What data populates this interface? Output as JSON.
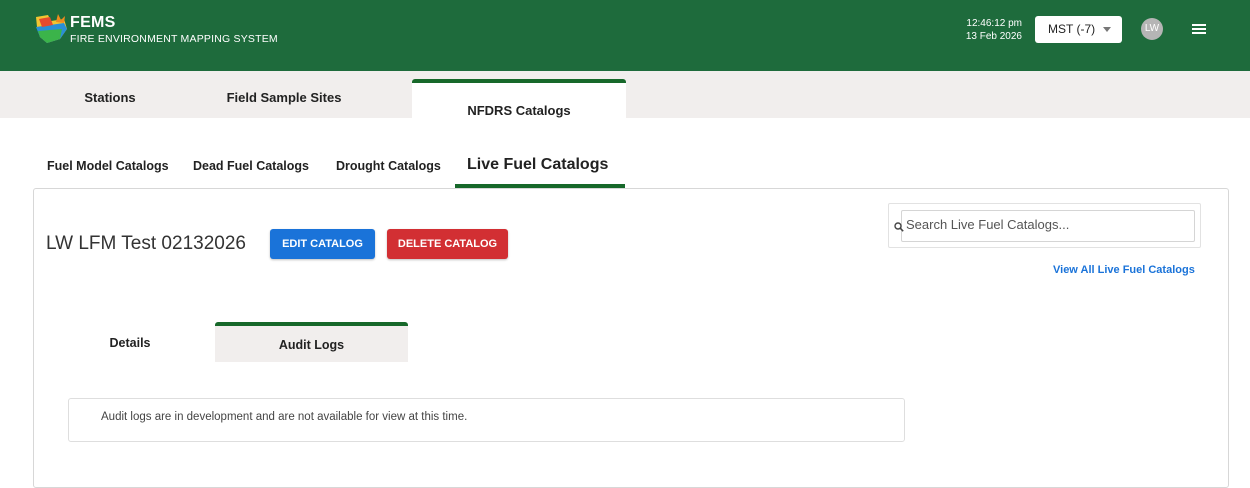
{
  "header": {
    "app_name": "FEMS",
    "app_subtitle": "FIRE ENVIRONMENT MAPPING SYSTEM",
    "time": "12:46:12 pm",
    "date": "13 Feb 2026",
    "timezone": "MST (-7)",
    "avatar_initials": "LW",
    "logo_icon": "fems-logo-icon",
    "menu_icon": "hamburger-menu-icon",
    "bg_color": "#1e6b3c"
  },
  "topnav": {
    "tabs": [
      {
        "label": "Stations",
        "active": false
      },
      {
        "label": "Field Sample Sites",
        "active": false
      },
      {
        "label": "NFDRS Catalogs",
        "active": true
      }
    ]
  },
  "subnav": {
    "tabs": [
      {
        "label": "Fuel Model Catalogs",
        "active": false
      },
      {
        "label": "Dead Fuel Catalogs",
        "active": false
      },
      {
        "label": "Drought Catalogs",
        "active": false
      },
      {
        "label": "Live Fuel Catalogs",
        "active": true
      }
    ]
  },
  "catalog": {
    "title": "LW LFM Test 02132026",
    "edit_label": "EDIT CATALOG",
    "delete_label": "DELETE CATALOG"
  },
  "search": {
    "placeholder": "Search Live Fuel Catalogs...",
    "icon": "search-icon",
    "view_all_label": "View All Live Fuel Catalogs"
  },
  "detail_tabs": {
    "tabs": [
      {
        "label": "Details",
        "active": false
      },
      {
        "label": "Audit Logs",
        "active": true
      }
    ]
  },
  "notice": {
    "text": "Audit logs are in development and are not available for view at this time."
  },
  "colors": {
    "accent_green": "#17682a",
    "primary_blue": "#1a73d9",
    "danger_red": "#d22f33"
  }
}
